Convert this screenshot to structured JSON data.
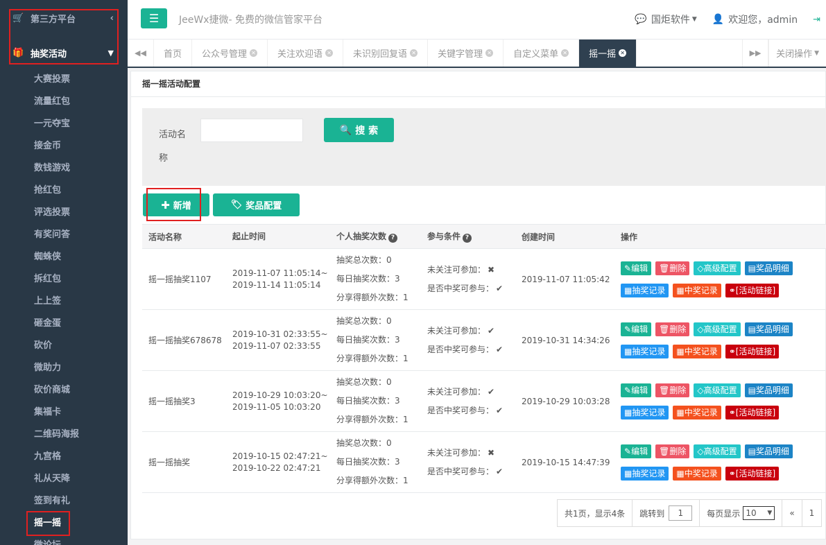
{
  "sidebar": {
    "platform": "第三方平台",
    "group": "抽奖活动",
    "items": [
      "大赛投票",
      "流量红包",
      "一元夺宝",
      "接金币",
      "数钱游戏",
      "抢红包",
      "评选投票",
      "有奖问答",
      "蜘蛛侠",
      "拆红包",
      "上上签",
      "砸金蛋",
      "砍价",
      "微助力",
      "砍价商城",
      "集福卡",
      "二维码海报",
      "九宫格",
      "礼从天降",
      "签到有礼",
      "摇一摇",
      "微论坛"
    ]
  },
  "topbar": {
    "brand": "JeeWx捷微- 免费的微信管家平台",
    "company": "国炬软件",
    "welcome": "欢迎您，admin"
  },
  "tabs": [
    "首页",
    "公众号管理",
    "关注欢迎语",
    "未识别回复语",
    "关键字管理",
    "自定义菜单",
    "摇一摇"
  ],
  "tab_close_ops": "关闭操作",
  "panel": {
    "title": "摇一摇活动配置",
    "search_label": "活动名称",
    "search_input": "",
    "search_button": "搜 索",
    "add_button": "新增",
    "prize_button": "奖品配置"
  },
  "table": {
    "headers": [
      "活动名称",
      "起止时间",
      "个人抽奖次数",
      "参与条件",
      "创建时间",
      "操作"
    ],
    "rows": [
      {
        "name": "摇一摇抽奖1107",
        "start": "2019-11-07 11:05:14~",
        "end": "2019-11-14 11:05:14",
        "total": "抽奖总次数：0",
        "daily": "每日抽奖次数：3",
        "share": "分享得额外次数：1",
        "cond1": "未关注可参加：",
        "cond1_mark": "✖",
        "cond2": "是否中奖可参与：",
        "cond2_mark": "✔",
        "created": "2019-11-07 11:05:42"
      },
      {
        "name": "摇一摇抽奖678678",
        "start": "2019-10-31 02:33:55~",
        "end": "2019-11-07 02:33:55",
        "total": "抽奖总次数：0",
        "daily": "每日抽奖次数：3",
        "share": "分享得额外次数：1",
        "cond1": "未关注可参加：",
        "cond1_mark": "✔",
        "cond2": "是否中奖可参与：",
        "cond2_mark": "✔",
        "created": "2019-10-31 14:34:26"
      },
      {
        "name": "摇一摇抽奖3",
        "start": "2019-10-29 10:03:20~",
        "end": "2019-11-05 10:03:20",
        "total": "抽奖总次数：0",
        "daily": "每日抽奖次数：3",
        "share": "分享得额外次数：1",
        "cond1": "未关注可参加：",
        "cond1_mark": "✔",
        "cond2": "是否中奖可参与：",
        "cond2_mark": "✔",
        "created": "2019-10-29 10:03:28"
      },
      {
        "name": "摇一摇抽奖",
        "start": "2019-10-15 02:47:21~",
        "end": "2019-10-22 02:47:21",
        "total": "抽奖总次数：0",
        "daily": "每日抽奖次数：3",
        "share": "分享得额外次数：1",
        "cond1": "未关注可参加：",
        "cond1_mark": "✖",
        "cond2": "是否中奖可参与：",
        "cond2_mark": "✔",
        "created": "2019-10-15 14:47:39"
      }
    ],
    "ops": {
      "edit": "编辑",
      "delete": "删除",
      "advanced": "高级配置",
      "prize_detail": "奖品明细",
      "draw_record": "抽奖记录",
      "win_record": "中奖记录",
      "link": "[活动链接]"
    }
  },
  "pager": {
    "summary": "共1页，显示4条",
    "jump_label": "跳转到",
    "jump_value": "1",
    "per_page_label": "每页显示",
    "per_page_value": "10",
    "prev": "«",
    "page": "1"
  }
}
